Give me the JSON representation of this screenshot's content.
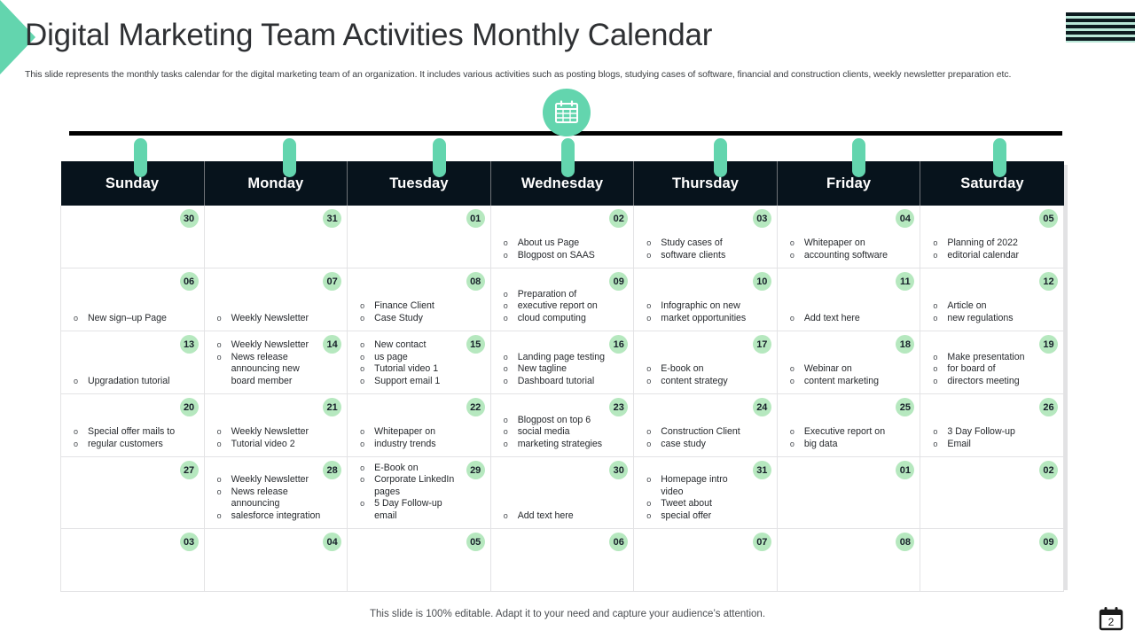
{
  "header": {
    "title": "Digital Marketing Team Activities Monthly Calendar",
    "subtitle": "This slide represents the monthly tasks calendar for the digital marketing team of an organization. It includes various activities such as posting blogs, studying cases of software, financial and construction clients, weekly newsletter preparation etc."
  },
  "colors": {
    "accent_green": "#63d5ae",
    "badge_green": "#b6e8bf",
    "header_dark": "#07131c",
    "text_dark": "#26292d"
  },
  "calendar": {
    "day_headers": [
      "Sunday",
      "Monday",
      "Tuesday",
      "Wednesday",
      "Thursday",
      "Friday",
      "Saturday"
    ],
    "weeks": [
      [
        {
          "date": "30",
          "tasks": []
        },
        {
          "date": "31",
          "tasks": []
        },
        {
          "date": "01",
          "tasks": []
        },
        {
          "date": "02",
          "tasks": [
            "About us Page",
            "Blogpost on SAAS"
          ]
        },
        {
          "date": "03",
          "tasks": [
            "Study cases of",
            "software clients"
          ]
        },
        {
          "date": "04",
          "tasks": [
            "Whitepaper on",
            "accounting software"
          ]
        },
        {
          "date": "05",
          "tasks": [
            "Planning of 2022",
            "editorial calendar"
          ]
        }
      ],
      [
        {
          "date": "06",
          "tasks": [
            "New sign–up Page"
          ]
        },
        {
          "date": "07",
          "tasks": [
            "Weekly Newsletter"
          ]
        },
        {
          "date": "08",
          "tasks": [
            "Finance Client",
            "Case Study"
          ]
        },
        {
          "date": "09",
          "tasks": [
            "Preparation of",
            "executive report on",
            "cloud computing"
          ]
        },
        {
          "date": "10",
          "tasks": [
            "Infographic on new",
            "market opportunities"
          ]
        },
        {
          "date": "11",
          "tasks": [
            "Add text here"
          ]
        },
        {
          "date": "12",
          "tasks": [
            "Article on",
            "new regulations"
          ]
        }
      ],
      [
        {
          "date": "13",
          "tasks": [
            "Upgradation tutorial"
          ]
        },
        {
          "date": "14",
          "tasks": [
            "Weekly Newsletter",
            "News release",
            "announcing new",
            "board member"
          ],
          "continuations": [
            2,
            3
          ]
        },
        {
          "date": "15",
          "tasks": [
            "New contact",
            "us page",
            "Tutorial video 1",
            "Support email 1"
          ]
        },
        {
          "date": "16",
          "tasks": [
            "Landing page testing",
            "New tagline",
            "Dashboard tutorial"
          ]
        },
        {
          "date": "17",
          "tasks": [
            "E-book on",
            "content strategy"
          ]
        },
        {
          "date": "18",
          "tasks": [
            "Webinar on",
            "content marketing"
          ]
        },
        {
          "date": "19",
          "tasks": [
            "Make presentation",
            "for board of",
            "directors meeting"
          ]
        }
      ],
      [
        {
          "date": "20",
          "tasks": [
            "Special offer mails to",
            "regular customers"
          ]
        },
        {
          "date": "21",
          "tasks": [
            "Weekly Newsletter",
            "Tutorial video 2"
          ]
        },
        {
          "date": "22",
          "tasks": [
            "Whitepaper on",
            "industry trends"
          ]
        },
        {
          "date": "23",
          "tasks": [
            "Blogpost on top 6",
            "social media",
            "marketing strategies"
          ]
        },
        {
          "date": "24",
          "tasks": [
            "Construction Client",
            "case study"
          ]
        },
        {
          "date": "25",
          "tasks": [
            "Executive report on",
            "big data"
          ]
        },
        {
          "date": "26",
          "tasks": [
            "3 Day Follow-up",
            "Email"
          ]
        }
      ],
      [
        {
          "date": "27",
          "tasks": []
        },
        {
          "date": "28",
          "tasks": [
            "Weekly Newsletter",
            "News release",
            "announcing",
            "salesforce integration"
          ],
          "continuations": [
            2
          ]
        },
        {
          "date": "29",
          "tasks": [
            "E-Book on",
            "Corporate LinkedIn",
            "pages",
            "5 Day Follow-up",
            "email"
          ],
          "continuations": [
            2,
            4
          ]
        },
        {
          "date": "30",
          "tasks": [
            "Add text here"
          ]
        },
        {
          "date": "31",
          "tasks": [
            "Homepage intro",
            "video",
            "Tweet about",
            "special offer"
          ],
          "continuations": [
            1
          ]
        },
        {
          "date": "01",
          "tasks": []
        },
        {
          "date": "02",
          "tasks": []
        }
      ],
      [
        {
          "date": "03",
          "tasks": []
        },
        {
          "date": "04",
          "tasks": []
        },
        {
          "date": "05",
          "tasks": []
        },
        {
          "date": "06",
          "tasks": []
        },
        {
          "date": "07",
          "tasks": []
        },
        {
          "date": "08",
          "tasks": []
        },
        {
          "date": "09",
          "tasks": []
        }
      ]
    ]
  },
  "footer": {
    "note": "This slide is 100% editable. Adapt it to your need and capture your audience’s attention.",
    "page_number": "2"
  }
}
